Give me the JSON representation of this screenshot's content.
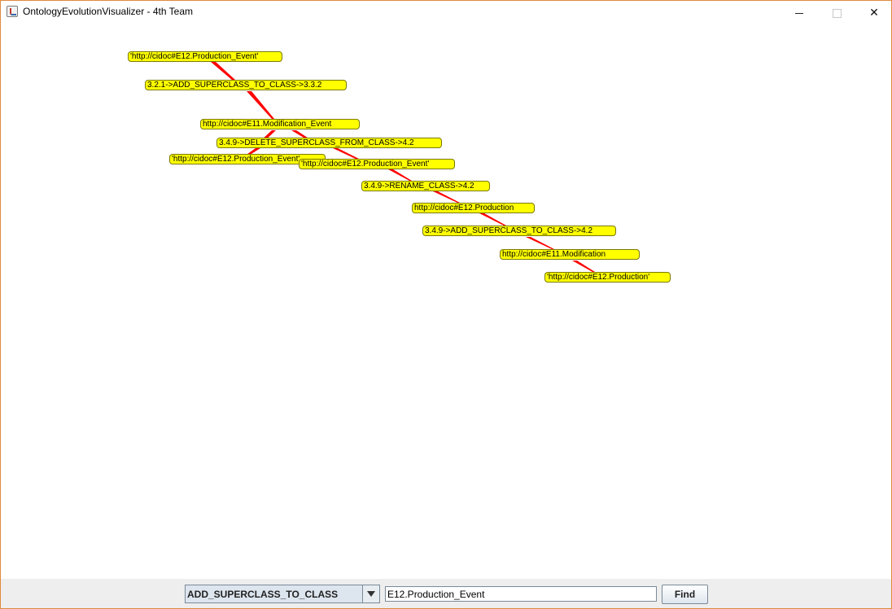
{
  "window": {
    "title": "OntologyEvolutionVisualizer - 4th Team"
  },
  "graph": {
    "node_color": "#ffff00",
    "edge_color": "#ff0000",
    "nodes": [
      {
        "label": "'http://cidoc#E12.Production_Event'"
      },
      {
        "label": "3.2.1->ADD_SUPERCLASS_TO_CLASS->3.3.2"
      },
      {
        "label": "http://cidoc#E11.Modification_Event"
      },
      {
        "label": "3.4.9->DELETE_SUPERCLASS_FROM_CLASS->4.2"
      },
      {
        "label": "'http://cidoc#E12.Production_Event'"
      },
      {
        "label": "'http://cidoc#E12.Production_Event'"
      },
      {
        "label": "3.4.9->RENAME_CLASS->4.2"
      },
      {
        "label": "http://cidoc#E12.Production"
      },
      {
        "label": "3.4.9->ADD_SUPERCLASS_TO_CLASS->4.2"
      },
      {
        "label": "http://cidoc#E11.Modification"
      },
      {
        "label": "'http://cidoc#E12.Production'"
      }
    ]
  },
  "controls": {
    "change_type_selected": "ADD_SUPERCLASS_TO_CLASS",
    "search_value": "E12.Production_Event",
    "find_label": "Find"
  }
}
